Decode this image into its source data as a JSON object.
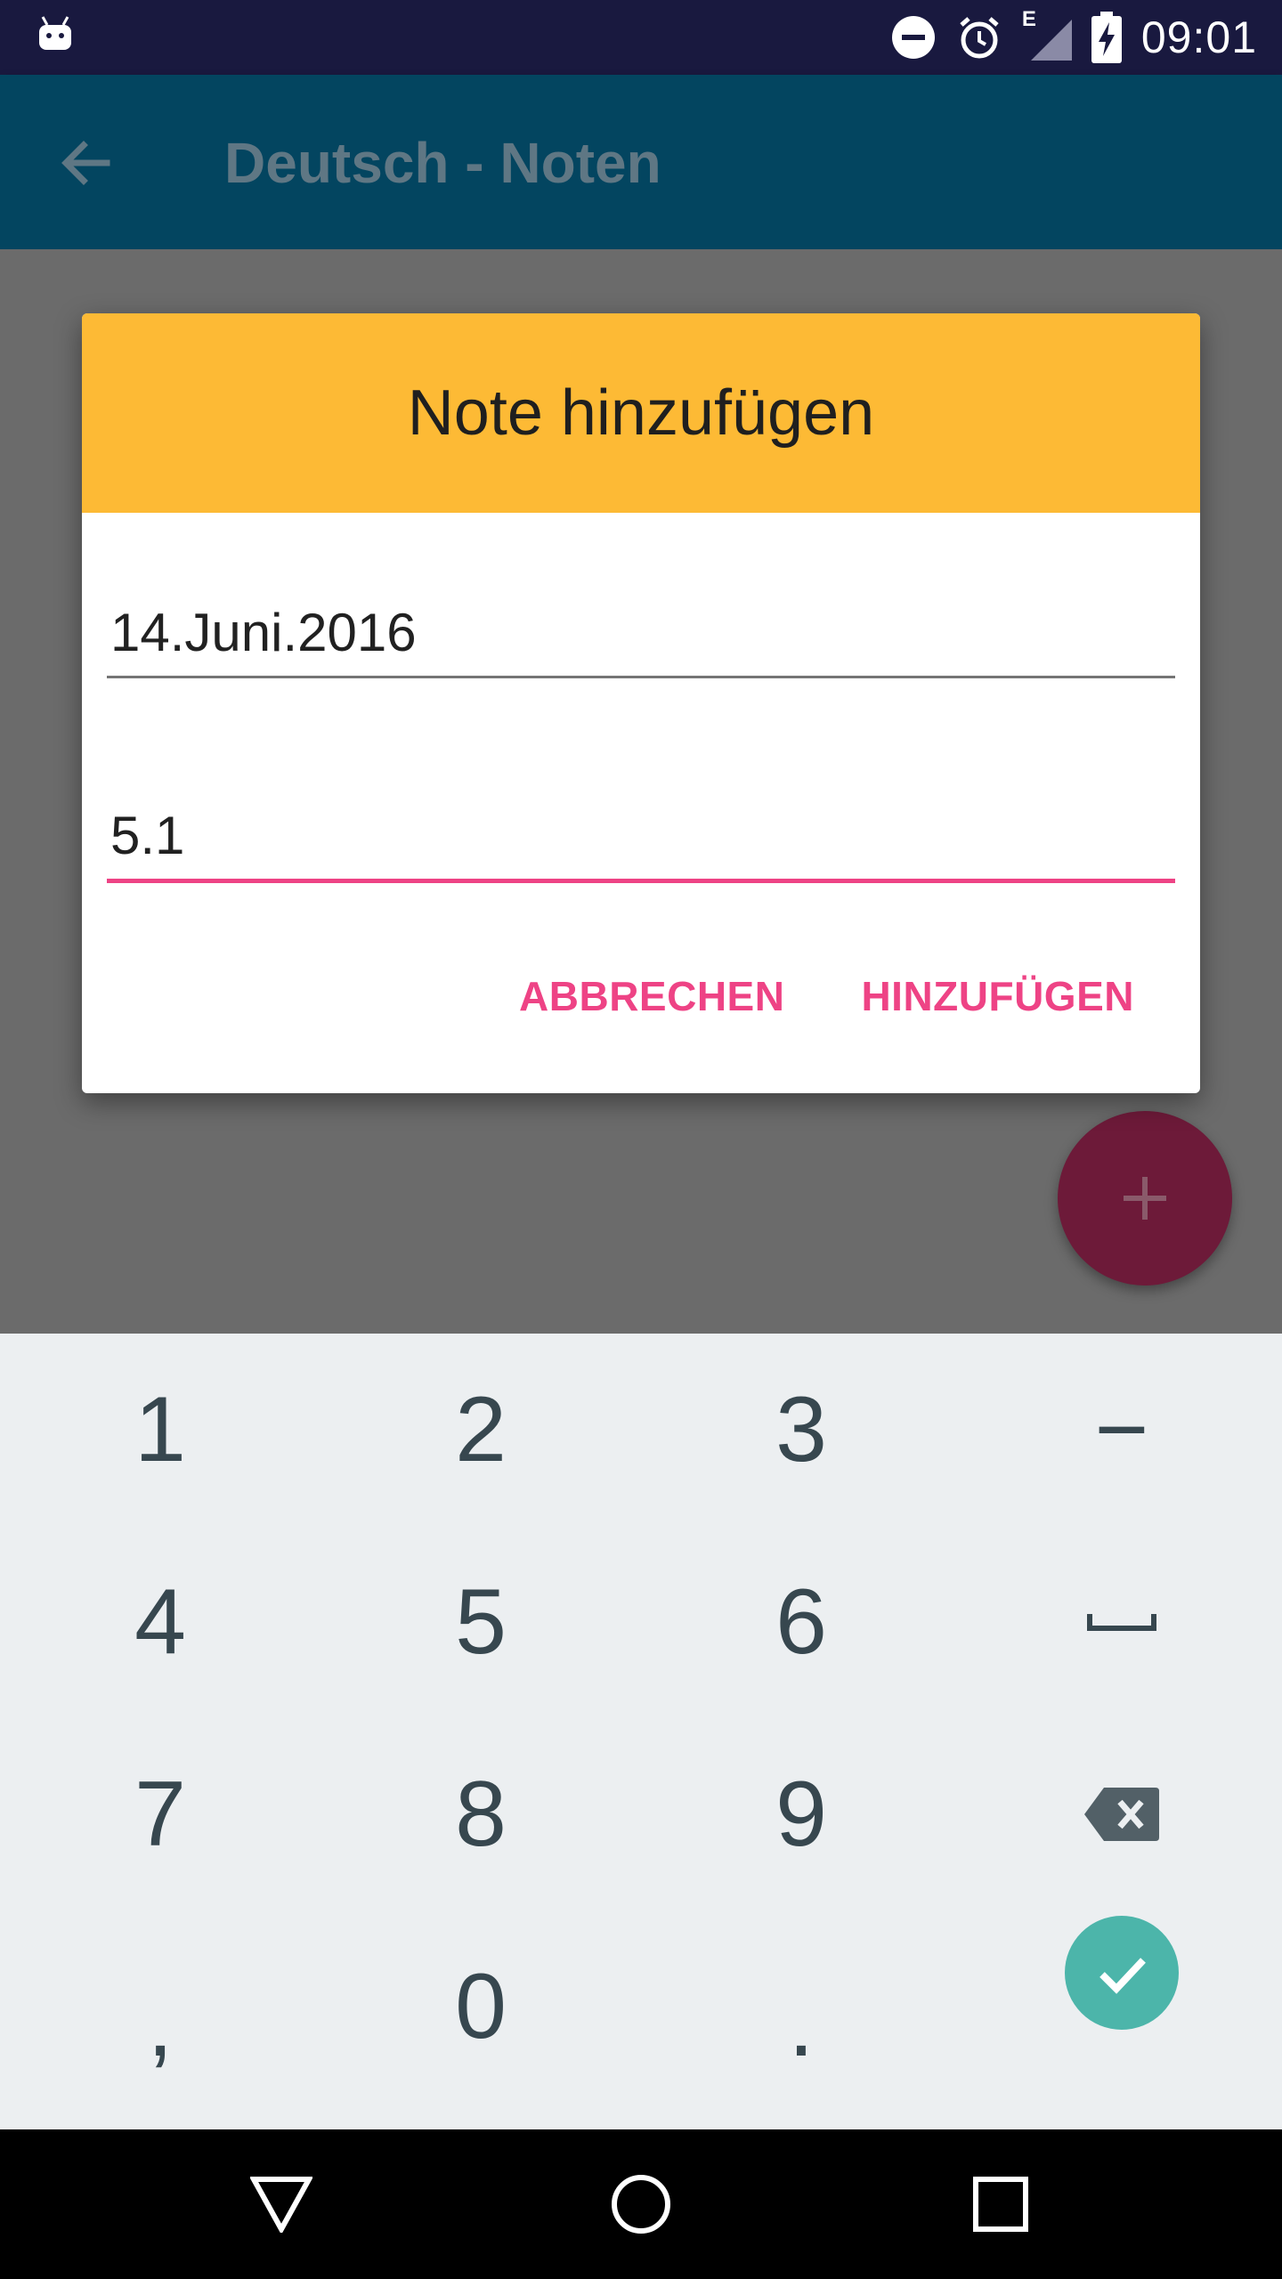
{
  "status_bar": {
    "time": "09:01",
    "network_label": "E",
    "icons": [
      "android-robot-icon",
      "dnd-icon",
      "alarm-icon",
      "signal-icon",
      "battery-charging-icon"
    ]
  },
  "app_bar": {
    "title": "Deutsch - Noten",
    "back_icon": "arrow-back-icon"
  },
  "dialog": {
    "title": "Note hinzufügen",
    "date_value": "14.Juni.2016",
    "grade_value": "5.1",
    "cancel_label": "ABBRECHEN",
    "add_label": "HINZUFÜGEN"
  },
  "fab": {
    "icon": "plus-icon"
  },
  "keyboard": {
    "row1": [
      "1",
      "2",
      "3",
      "−"
    ],
    "row2": [
      "4",
      "5",
      "6",
      "space-icon"
    ],
    "row3": [
      "7",
      "8",
      "9",
      "backspace-icon"
    ],
    "row4": [
      ",",
      "0",
      ".",
      "done-check-icon"
    ]
  },
  "navigation_bar": [
    "back-triangle-icon",
    "home-circle-icon",
    "recents-square-icon"
  ],
  "colors": {
    "status_bar": "#19193f",
    "app_bar": "#034560",
    "dialog_header": "#fdba35",
    "accent_pink": "#ee4385",
    "fab": "#6d1a39",
    "keyboard_bg": "#eceff1",
    "key_text": "#37474f",
    "done_key": "#4cb5aa"
  }
}
